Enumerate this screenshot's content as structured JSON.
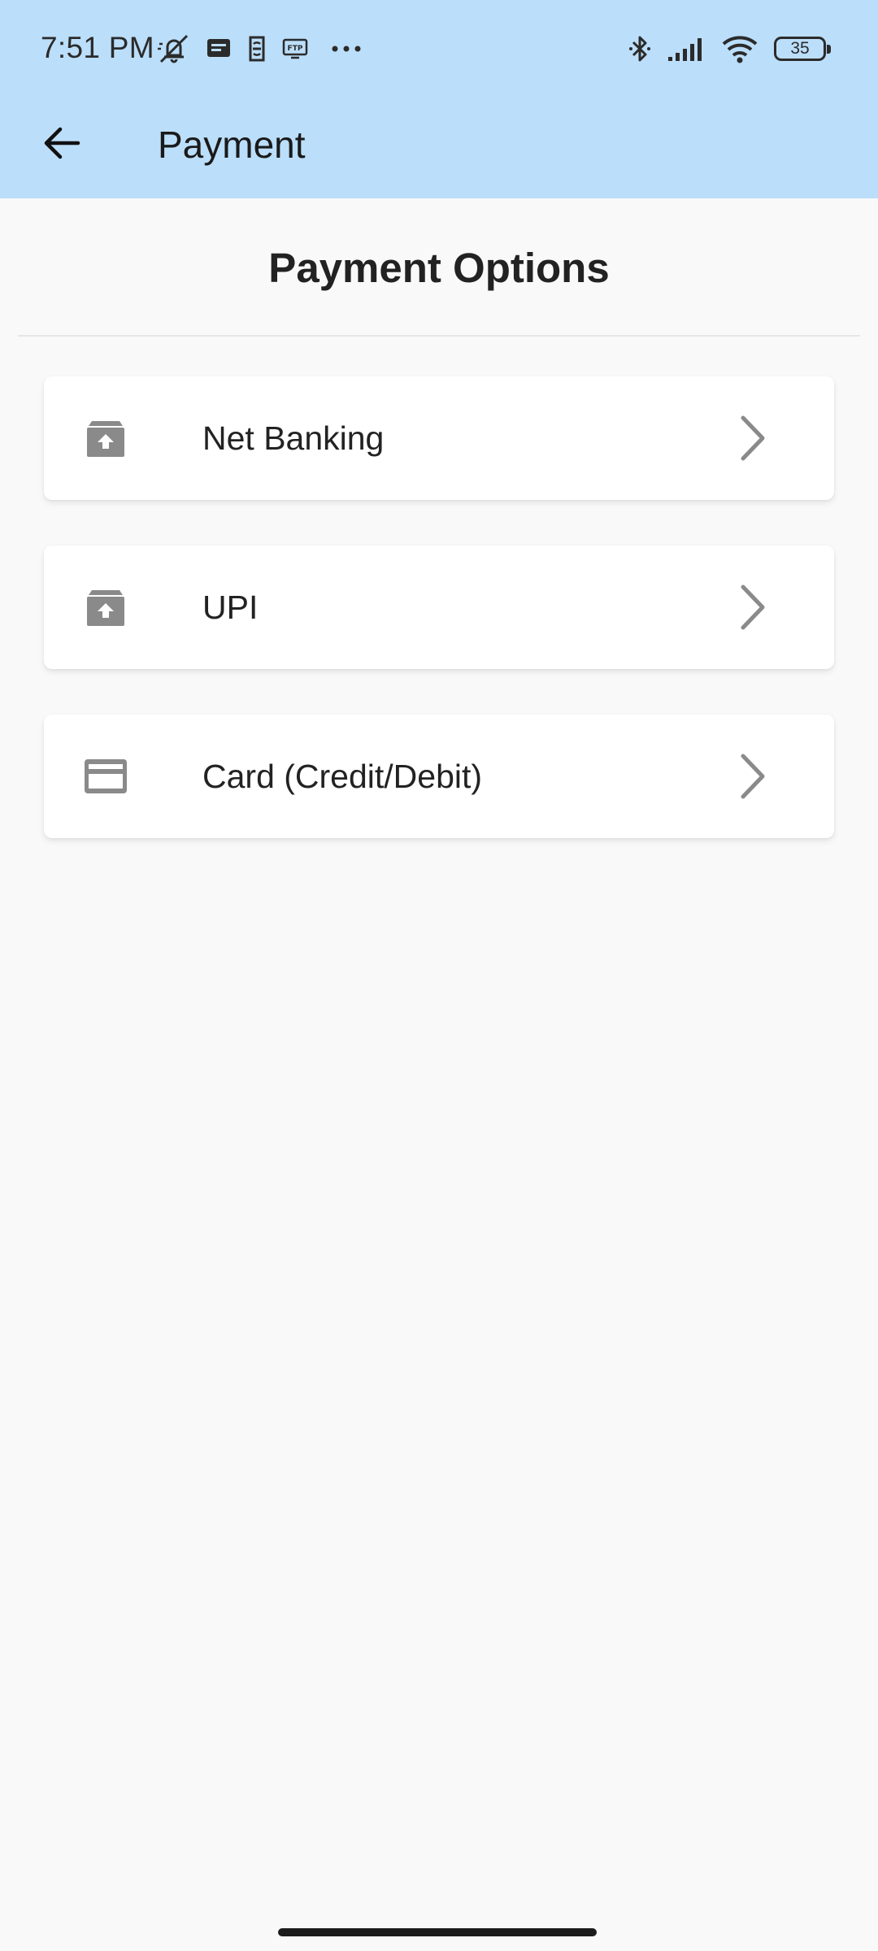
{
  "status_bar": {
    "time": "7:51 PM",
    "battery_level": "35",
    "left_icons": [
      "muted-bell-icon",
      "message-icon",
      "sim-icon",
      "ftp-icon",
      "more-dots-icon"
    ],
    "right_icons": [
      "bluetooth-icon",
      "signal-icon",
      "wifi-icon",
      "battery-icon"
    ]
  },
  "app_bar": {
    "title": "Payment",
    "back_icon": "back-arrow-icon",
    "background_color": "#bbdefa"
  },
  "page": {
    "heading": "Payment Options"
  },
  "payment_options": [
    {
      "label": "Net Banking",
      "icon": "archive-upload-icon"
    },
    {
      "label": "UPI",
      "icon": "archive-upload-icon"
    },
    {
      "label": "Card (Credit/Debit)",
      "icon": "credit-card-icon"
    }
  ],
  "colors": {
    "header": "#bbdefa",
    "background": "#f9f9f9",
    "card": "#ffffff",
    "icon_gray": "#8a8a8a"
  }
}
